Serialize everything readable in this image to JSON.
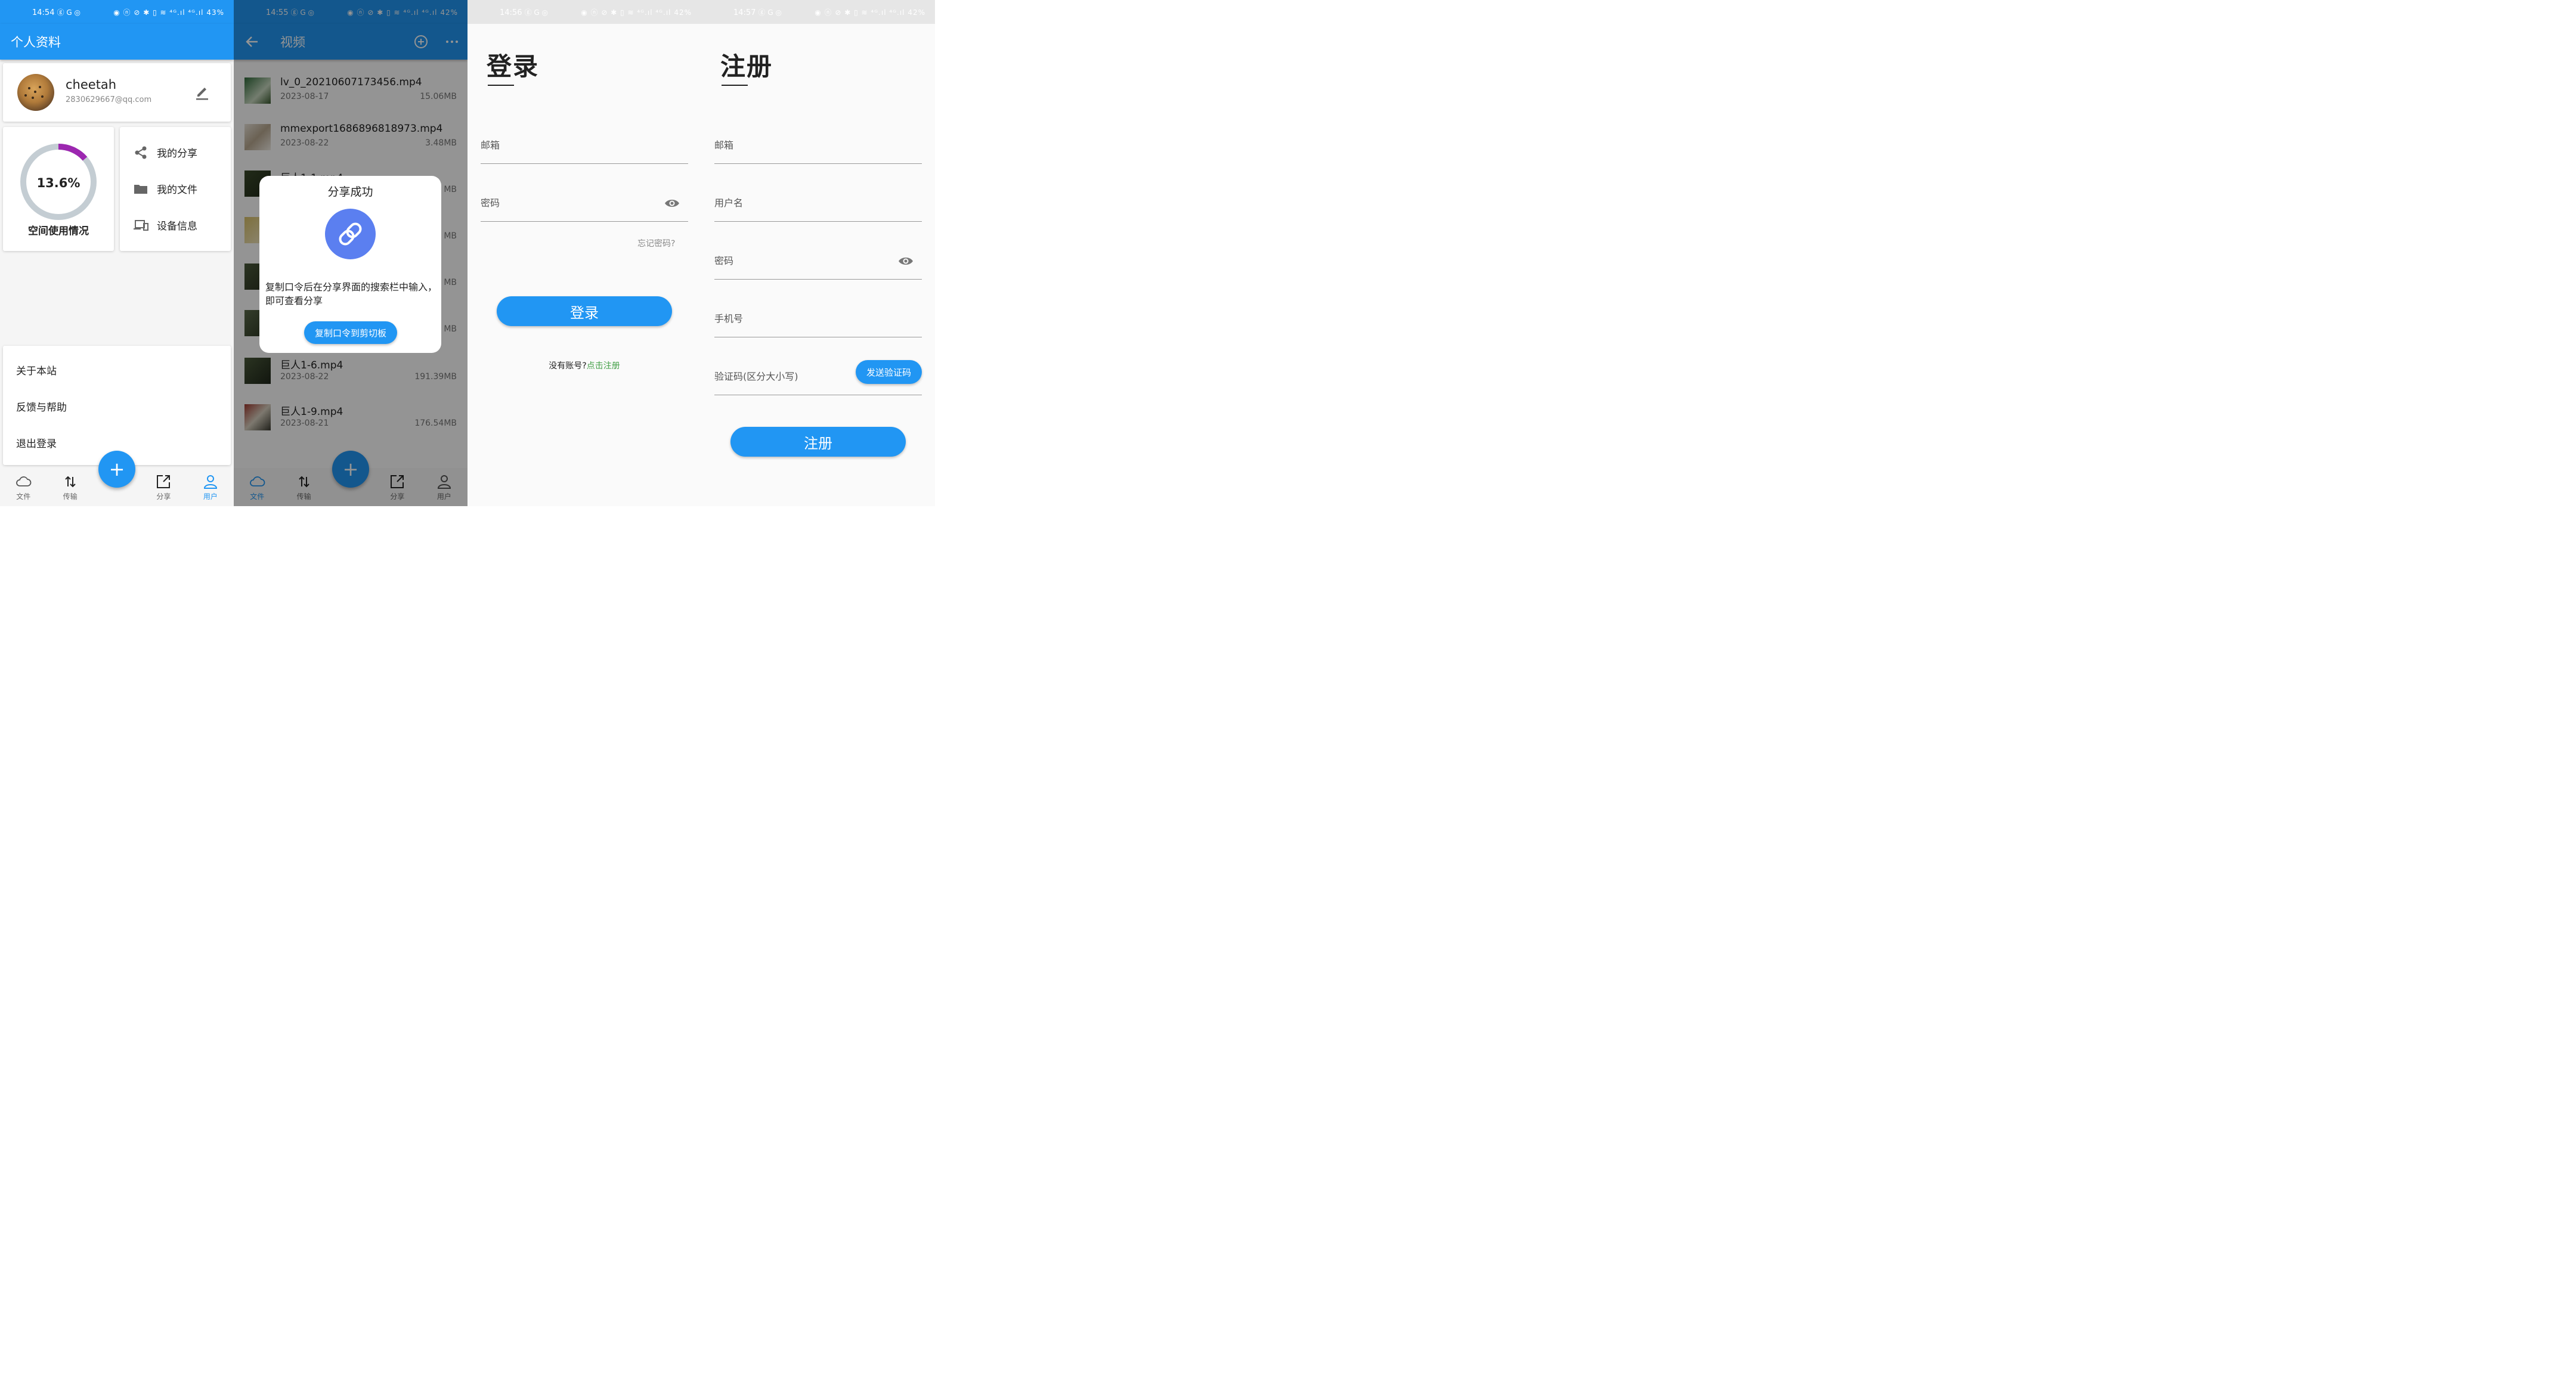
{
  "colors": {
    "primary": "#2196f3",
    "dark_primary": "#17589c",
    "ring_track": "#c4cdd3",
    "ring_fill": "#9c27b0",
    "link_green": "#43a047",
    "dim": "rgba(0,0,0,0.42)"
  },
  "profile_screen": {
    "status": {
      "time": "14:54",
      "left_icons": "ⓖ G ◎",
      "right_icons": "◉ ⓝ ⊘ ✱ ▯ ≋ ⁴ᴳ.ıl ⁴ᴳ.ıl",
      "battery": "43%"
    },
    "title": "个人资料",
    "user": {
      "name": "cheetah",
      "email": "2830629667@qq.com"
    },
    "storage": {
      "percent_text": "13.6%",
      "fraction": 0.136,
      "label": "空间使用情况"
    },
    "menu": [
      "我的分享",
      "我的文件",
      "设备信息"
    ],
    "bottom_list": [
      "关于本站",
      "反馈与帮助",
      "退出登录"
    ],
    "fab": "+",
    "nav": [
      {
        "label": "文件",
        "icon": "cloud-icon"
      },
      {
        "label": "传输",
        "icon": "transfer-icon"
      },
      {
        "label": "分享",
        "icon": "share-out-icon"
      },
      {
        "label": "用户",
        "icon": "user-icon"
      }
    ],
    "active_nav": "用户"
  },
  "video_screen": {
    "status": {
      "time": "14:55",
      "left_icons": "ⓖ G ◎",
      "right_icons": "◉ ⓝ ⊘ ✱ ▯ ≋ ⁴ᴳ.ıl ⁴ᴳ.ıl",
      "battery": "42%"
    },
    "title": "视频",
    "files": [
      {
        "name": "lv_0_20210607173456.mp4",
        "date": "2023-08-17",
        "size": "15.06MB"
      },
      {
        "name": "mmexport1686896818973.mp4",
        "date": "2023-08-22",
        "size": "3.48MB"
      },
      {
        "name": "巨人1-1.mp4",
        "date": "",
        "size": "MB"
      },
      {
        "name": "",
        "date": "",
        "size": "MB"
      },
      {
        "name": "",
        "date": "",
        "size": "MB"
      },
      {
        "name": "",
        "date": "",
        "size": "MB"
      },
      {
        "name": "巨人1-6.mp4",
        "date": "2023-08-22",
        "size": "191.39MB"
      },
      {
        "name": "巨人1-9.mp4",
        "date": "2023-08-21",
        "size": "176.54MB"
      }
    ],
    "dialog": {
      "title": "分享成功",
      "message": "复制口令后在分享界面的搜索栏中输入，即可查看分享",
      "button": "复制口令到剪切板"
    },
    "fab": "+",
    "nav": [
      {
        "label": "文件",
        "icon": "cloud-icon"
      },
      {
        "label": "传输",
        "icon": "transfer-icon"
      },
      {
        "label": "分享",
        "icon": "share-out-icon"
      },
      {
        "label": "用户",
        "icon": "user-icon"
      }
    ],
    "active_nav": "文件"
  },
  "login_screen": {
    "status": {
      "time": "14:56",
      "left_icons": "ⓖ G ◎",
      "right_icons": "◉ ⓝ ⊘ ✱ ▯ ≋ ⁴ᴳ.ıl ⁴ᴳ.ıl",
      "battery": "42%"
    },
    "title": "登录",
    "email_label": "邮箱",
    "password_label": "密码",
    "forgot": "忘记密码?",
    "button": "登录",
    "no_account": "没有账号?",
    "register_link": "点击注册"
  },
  "register_screen": {
    "status": {
      "time": "14:57",
      "left_icons": "ⓖ G ◎",
      "right_icons": "◉ ⓝ ⊘ ✱ ▯ ≋ ⁴ᴳ.ıl ⁴ᴳ.ıl",
      "battery": "42%"
    },
    "title": "注册",
    "email_label": "邮箱",
    "username_label": "用户名",
    "password_label": "密码",
    "phone_label": "手机号",
    "code_label": "验证码(区分大小写)",
    "send_code": "发送验证码",
    "button": "注册"
  }
}
